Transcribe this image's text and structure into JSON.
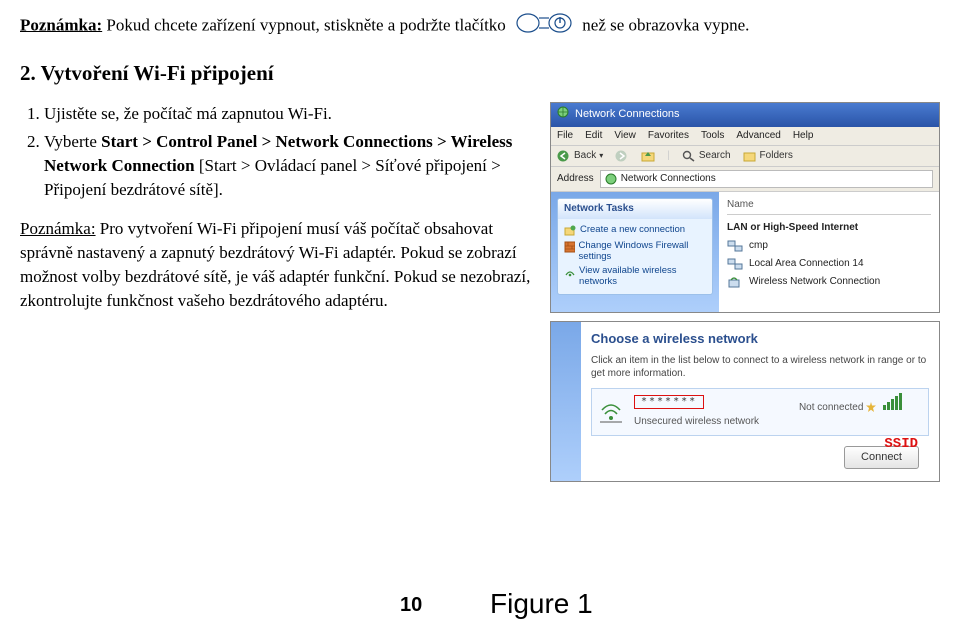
{
  "topnote": {
    "label": "Poznámka:",
    "text1": " Pokud chcete zařízení vypnout, stiskněte a podržte tlačítko ",
    "text2": "než se obrazovka vypne."
  },
  "heading": "2. Vytvoření Wi-Fi připojení",
  "steps": {
    "s1": "Ujistěte se, že počítač má zapnutou Wi-Fi.",
    "s2a": "Vyberte ",
    "s2b": "Start > Control Panel > Network Connections > Wireless Network Connection",
    "s2c": " [Start > Ovládací panel > Síťové připojení > Připojení bezdrátové sítě]."
  },
  "note2": {
    "label": "Poznámka:",
    "text": " Pro vytvoření Wi-Fi připojení musí váš počítač obsahovat správně nastavený a zapnutý bezdrátový Wi-Fi adaptér. Pokud se zobrazí možnost volby bezdrátové sítě, je váš adaptér funkční. Pokud se nezobrazí, zkontrolujte funkčnost vašeho bezdrátového adaptéru."
  },
  "win1": {
    "title": "Network Connections",
    "menu": [
      "File",
      "Edit",
      "View",
      "Favorites",
      "Tools",
      "Advanced",
      "Help"
    ],
    "toolbar": {
      "back": "Back",
      "search": "Search",
      "folders": "Folders"
    },
    "address_label": "Address",
    "address_value": "Network Connections",
    "side_header": "Network Tasks",
    "side_items": [
      "Create a new connection",
      "Change Windows Firewall settings",
      "View available wireless networks"
    ],
    "col_name": "Name",
    "group": "LAN or High-Speed Internet",
    "items": [
      "cmp",
      "Local Area Connection 14",
      "Wireless Network Connection"
    ]
  },
  "win2": {
    "title": "Choose a wireless network",
    "desc": "Click an item in the list below to connect to a wireless network in range or to get more information.",
    "ssid_mask": "*******",
    "notconn": "Not connected",
    "netdesc": "Unsecured wireless network",
    "ssid_label": "SSID",
    "connect": "Connect"
  },
  "icons": {
    "power": "power-icon",
    "globe": "globe-icon",
    "back": "back-arrow-icon",
    "search": "search-icon",
    "folders": "folders-icon",
    "netfolder": "network-folder-icon",
    "signal": "wifi-signal-icon",
    "star": "favorite-icon"
  },
  "page": "10",
  "figure": "Figure 1"
}
